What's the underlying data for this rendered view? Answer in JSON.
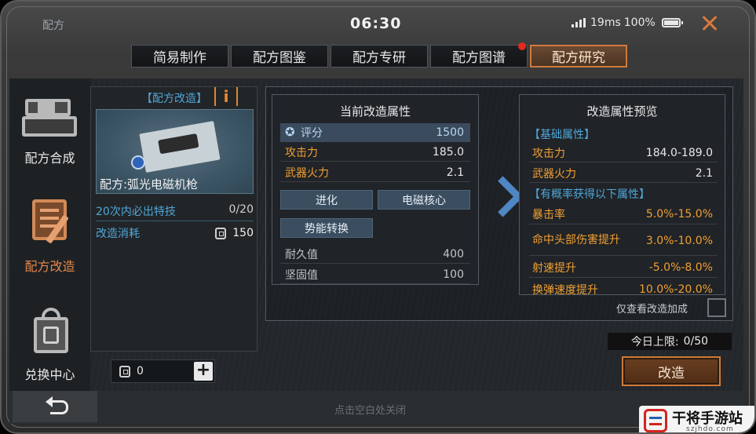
{
  "window": {
    "title": "配方",
    "time": "06:30",
    "ping": "19ms",
    "battery": "100%"
  },
  "tabs": [
    {
      "label": "简易制作"
    },
    {
      "label": "配方图鉴"
    },
    {
      "label": "配方专研"
    },
    {
      "label": "配方图谱",
      "has_notification": true
    },
    {
      "label": "配方研究",
      "active": true
    }
  ],
  "sidebar": {
    "items": [
      {
        "label": "配方合成",
        "icon": "craft-machine-icon"
      },
      {
        "label": "配方改造",
        "icon": "clipboard-edit-icon",
        "active": true
      },
      {
        "label": "兑换中心",
        "icon": "shopping-bag-icon"
      }
    ]
  },
  "recipe": {
    "header": "【配方改造】",
    "info_label": "i",
    "name": "配方:弧光电磁机枪",
    "guarantee_label": "20次内必出特技",
    "guarantee_value": "0/20",
    "cost_label": "改造消耗",
    "cost_value": "150"
  },
  "currency": {
    "amount": "0",
    "add_label": "+"
  },
  "current": {
    "title": "当前改造属性",
    "score_label": "评分",
    "score_value": "1500",
    "stats": [
      {
        "label": "攻击力",
        "value": "185.0"
      },
      {
        "label": "武器火力",
        "value": "2.1"
      }
    ],
    "traits": [
      "进化",
      "电磁核心",
      "势能转换"
    ],
    "durability": [
      {
        "label": "耐久值",
        "value": "400"
      },
      {
        "label": "坚固值",
        "value": "100"
      }
    ]
  },
  "preview": {
    "title": "改造属性预览",
    "base_section": "【基础属性】",
    "base": [
      {
        "label": "攻击力",
        "value": "184.0-189.0"
      },
      {
        "label": "武器火力",
        "value": "2.1"
      }
    ],
    "chance_section": "【有概率获得以下属性】",
    "chance": [
      {
        "label": "暴击率",
        "value": "5.0%-15.0%"
      },
      {
        "label": "命中头部伤害提升",
        "value": "3.0%-10.0%"
      },
      {
        "label": "射速提升",
        "value": "-5.0%-8.0%"
      },
      {
        "label": "换弹速度提升",
        "value": "10.0%-20.0%"
      }
    ]
  },
  "filter": {
    "only_mod_label": "仅查看改造加成"
  },
  "daily": {
    "label": "今日上限:",
    "value": "0/50"
  },
  "actions": {
    "modify_label": "改造",
    "close_hint": "点击空白处关闭"
  },
  "watermark": {
    "text": "干将手游站",
    "url": "szjhdo.com"
  },
  "colors": {
    "accent": "#d07a3d",
    "blue_label": "#4fa7d9",
    "orange_stat": "#f0a033"
  }
}
